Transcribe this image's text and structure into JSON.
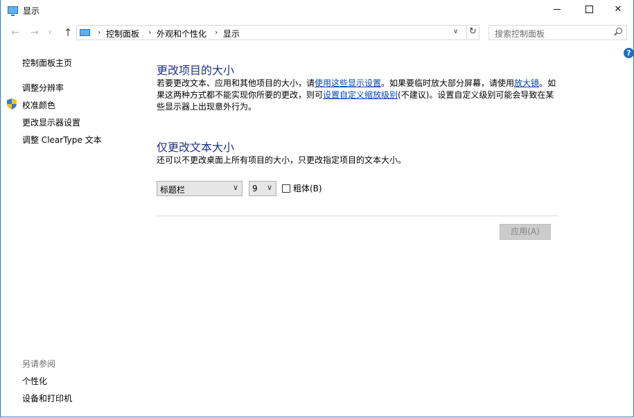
{
  "window": {
    "title": "显示",
    "minimize_icon": "minimize-icon",
    "maximize_icon": "maximize-icon",
    "close_label": "✕"
  },
  "address_bar": {
    "breadcrumbs": [
      "控制面板",
      "外观和个性化",
      "显示"
    ],
    "separator": "›",
    "refresh_icon": "↻",
    "dropdown_icon": "∨"
  },
  "nav": {
    "back": "←",
    "forward": "→",
    "recent": "∨",
    "up": "↑"
  },
  "search": {
    "placeholder": "搜索控制面板"
  },
  "help": {
    "label": "?"
  },
  "sidebar": {
    "home": "控制面板主页",
    "items": [
      "调整分辨率",
      "校准颜色",
      "更改显示器设置",
      "调整 ClearType 文本"
    ],
    "see_also_title": "另请参阅",
    "see_also": [
      "个性化",
      "设备和打印机"
    ]
  },
  "section1": {
    "heading": "更改项目的大小",
    "text1": "若要更改文本、应用和其他项目的大小，请",
    "link1": "使用这些显示设置",
    "text2": "。如果要临时放大部分屏幕，请使用",
    "link2": "放大镜",
    "text3": "。如果这两种方式都不能实现你所要的更改，则可",
    "link3": "设置自定义缩放级别",
    "text4": "(不建议)。设置自定义级别可能会导致在某些显示器上出现意外行为。"
  },
  "section2": {
    "heading": "仅更改文本大小",
    "description": "还可以不更改桌面上所有项目的大小，只更改指定项目的文本大小。",
    "item_select": "标题栏",
    "size_select": "9",
    "bold_label": "粗体(B)",
    "bold_checked": false
  },
  "apply_button": "应用(A)"
}
